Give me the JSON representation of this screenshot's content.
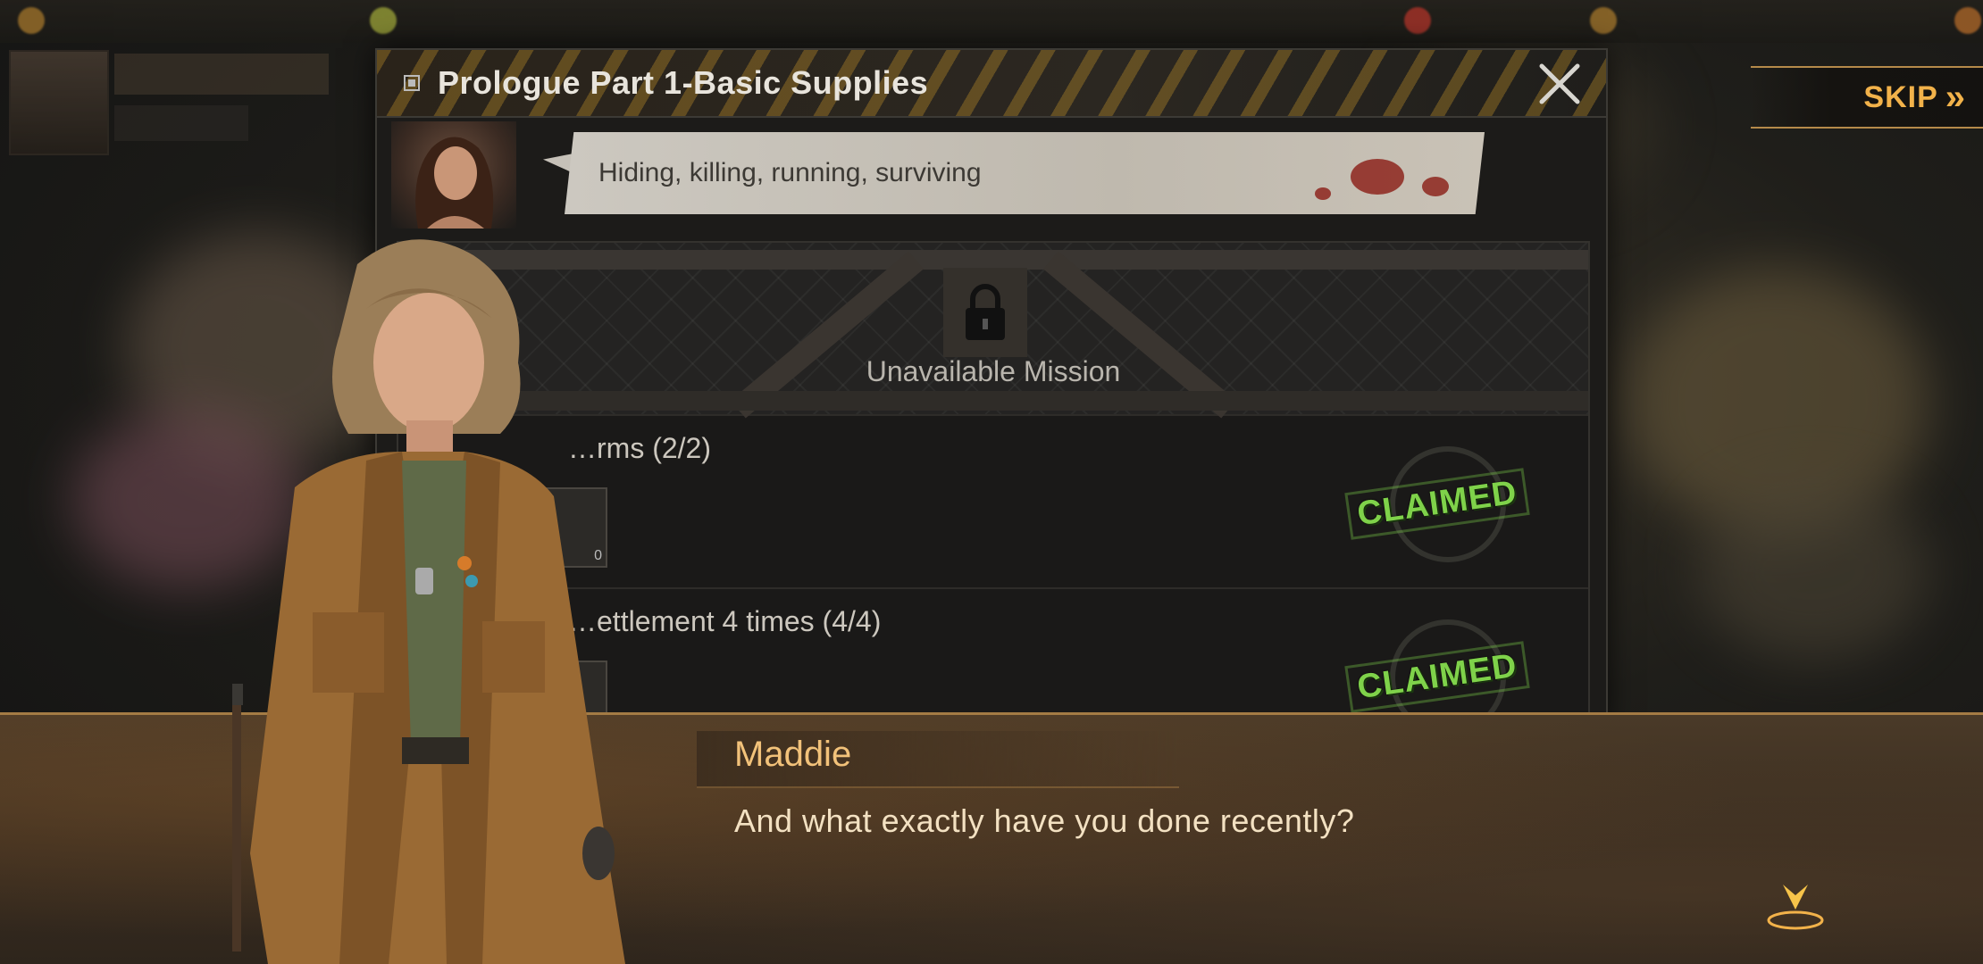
{
  "header": {
    "title": "Prologue Part 1-Basic Supplies"
  },
  "skip": {
    "label": "SKIP",
    "icon": "double-chevron-right-icon"
  },
  "npc": {
    "speech": "Hiding, killing, running, surviving"
  },
  "missions": {
    "locked_label": "Unavailable Mission",
    "items": [
      {
        "title": "…rms (2/2)",
        "reward_count": "0",
        "status": "CLAIMED"
      },
      {
        "title": "…ettlement 4 times (4/4)",
        "status": "CLAIMED"
      }
    ]
  },
  "dialogue": {
    "speaker": "Maddie",
    "line": "And what exactly have you done recently?"
  },
  "colors": {
    "accent": "#f2b24a",
    "claimed": "#7fd24a",
    "speaker": "#f2c27a"
  }
}
